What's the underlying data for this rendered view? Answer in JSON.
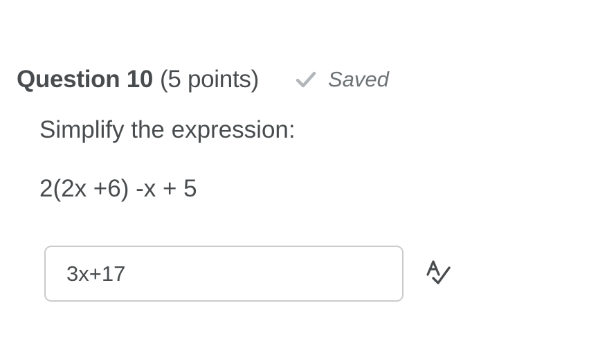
{
  "question": {
    "title": "Question 10",
    "points": "(5 points)",
    "status": {
      "label": "Saved",
      "icon": "check-icon"
    },
    "prompt": "Simplify the expression:",
    "expression": "2(2x +6) -x + 5"
  },
  "answer": {
    "value": "3x+17"
  },
  "tools": {
    "spellcheck_icon": "spellcheck-icon"
  },
  "colors": {
    "text": "#494c4e",
    "muted": "#6e7376",
    "check": "#b3b6b9",
    "input_border": "#c9cbcd"
  }
}
